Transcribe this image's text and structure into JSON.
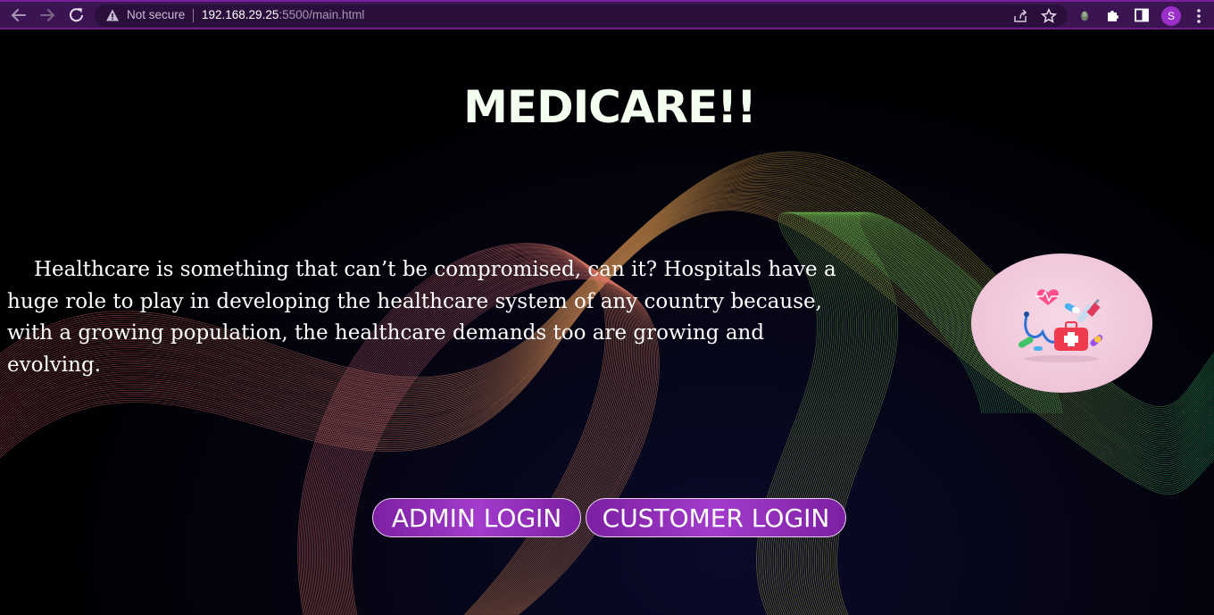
{
  "browser": {
    "security_label": "Not secure",
    "url_host": "192.168.29.25",
    "url_path": ":5500/main.html",
    "profile_initial": "S"
  },
  "page": {
    "title": "MEDICARE!!",
    "intro": "Healthcare is something that can’t be compromised, can it? Hospitals have a huge role to play in developing the healthcare system of any country because, with a growing population, the healthcare demands too are growing and evolving.",
    "buttons": {
      "admin_login": "ADMIN LOGIN",
      "customer_login": "CUSTOMER LOGIN"
    }
  },
  "colors": {
    "browser_bar": "#3b1452",
    "title_text": "#f4fff0",
    "button_fill": "#9a2fc4",
    "logo_background": "#efc4d8"
  },
  "icons": {
    "back": "arrow-left-icon",
    "forward": "arrow-right-icon",
    "reload": "reload-icon",
    "warning": "warning-triangle-icon",
    "share": "share-icon",
    "bookmark": "star-icon",
    "extension_1": "extension-icon",
    "extensions": "puzzle-icon",
    "side_panel": "side-panel-icon",
    "menu": "kebab-menu-icon",
    "logo": "medical-kit-icon"
  }
}
